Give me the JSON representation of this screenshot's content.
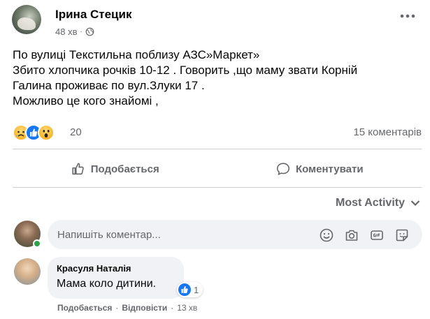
{
  "post": {
    "author": "Ірина Стецик",
    "time": "48 хв",
    "separator": "·",
    "body_lines": [
      "По вулиці Текстильна поблизу АЗС»Маркет»",
      "Збито хлопчика рочків 10-12 . Говорить ,що маму звати Корній",
      "Галина проживає по вул.Злуки 17 .",
      "Можливо це кого знайомі ,"
    ],
    "reaction_count": "20",
    "reactions": [
      "sad-icon",
      "like-icon",
      "wow-icon"
    ],
    "comments_count": "15 коментарів"
  },
  "actions": {
    "like_label": "Подобається",
    "comment_label": "Коментувати"
  },
  "sort": {
    "label": "Most Activity"
  },
  "composer": {
    "placeholder": "Напишіть коментар..."
  },
  "comment": {
    "author": "Красуля Наталія",
    "text": "Мама коло дитини.",
    "reaction_count": "1",
    "like_label": "Подобається",
    "reply_label": "Відповісти",
    "separator": "·",
    "time": "13 хв"
  },
  "colors": {
    "brand_blue": "#1877f2",
    "secondary_text": "#65676b",
    "input_bg": "#f0f2f5",
    "online_green": "#31a24c"
  }
}
